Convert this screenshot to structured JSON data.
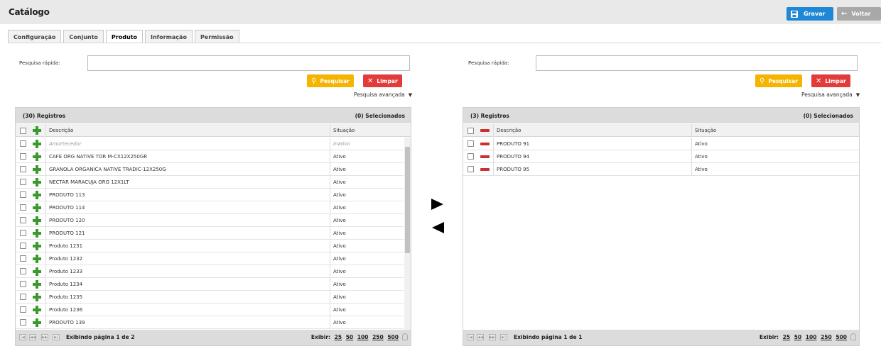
{
  "header": {
    "title": "Catálogo",
    "save_label": "Gravar",
    "back_label": "Voltar",
    "colors": {
      "save": "#1e88d6",
      "back": "#a8a8a8",
      "search": "#f5b400",
      "clear": "#e23b3b",
      "add": "#3a9a2c",
      "remove": "#cc2f2f"
    }
  },
  "tabs": [
    {
      "label": "Configuração",
      "active": false
    },
    {
      "label": "Conjunto",
      "active": false
    },
    {
      "label": "Produto",
      "active": true
    },
    {
      "label": "Informação",
      "active": false
    },
    {
      "label": "Permissão",
      "active": false
    }
  ],
  "left": {
    "search_label": "Pesquisa rápida:",
    "search_value": "",
    "search_button": "Pesquisar",
    "clear_button": "Limpar",
    "advanced": "Pesquisa avançada",
    "records": "(30) Registros",
    "selected": "(0) Selecionados",
    "col_desc": "Descrição",
    "col_status": "Situação",
    "rows": [
      {
        "desc": "Amortecedor",
        "status": "Inativo",
        "inactive": true
      },
      {
        "desc": "CAFE ORG NATIVE TOR M-CX12X250GR",
        "status": "Ativo"
      },
      {
        "desc": "GRANOLA ORGANICA NATIVE TRADIC-12X250G",
        "status": "Ativo"
      },
      {
        "desc": "NECTAR MARACUJA ORG 12X1LT",
        "status": "Ativo"
      },
      {
        "desc": "PRODUTO 113",
        "status": "Ativo"
      },
      {
        "desc": "PRODUTO 114",
        "status": "Ativo"
      },
      {
        "desc": "PRODUTO 120",
        "status": "Ativo"
      },
      {
        "desc": "PRODUTO 121",
        "status": "Ativo"
      },
      {
        "desc": "Produto 1231",
        "status": "Ativo"
      },
      {
        "desc": "Produto 1232",
        "status": "Ativo"
      },
      {
        "desc": "Produto 1233",
        "status": "Ativo"
      },
      {
        "desc": "Produto 1234",
        "status": "Ativo"
      },
      {
        "desc": "Produto 1235",
        "status": "Ativo"
      },
      {
        "desc": "Produto 1236",
        "status": "Ativo"
      },
      {
        "desc": "PRODUTO 139",
        "status": "Ativo"
      }
    ],
    "page_text": "Exibindo página 1 de 2",
    "show_label": "Exibir:",
    "page_sizes": [
      "25",
      "50",
      "100",
      "250",
      "500"
    ]
  },
  "right": {
    "search_label": "Pesquisa rápida:",
    "search_value": "",
    "search_button": "Pesquisar",
    "clear_button": "Limpar",
    "advanced": "Pesquisa avançada",
    "records": "(3) Registros",
    "selected": "(0) Selecionados",
    "col_desc": "Descrição",
    "col_status": "Situação",
    "rows": [
      {
        "desc": "PRODUTO 91",
        "status": "Ativo"
      },
      {
        "desc": "PRODUTO 94",
        "status": "Ativo"
      },
      {
        "desc": "PRODUTO 95",
        "status": "Ativo"
      }
    ],
    "page_text": "Exibindo página 1 de 1",
    "show_label": "Exibir:",
    "page_sizes": [
      "25",
      "50",
      "100",
      "250",
      "500"
    ]
  },
  "icons": {
    "save": "floppy-icon",
    "back": "arrow-left-icon",
    "search": "magnifier-icon",
    "clear": "x-icon",
    "add": "plus-icon",
    "remove": "minus-icon",
    "move_right": "triangle-right-icon",
    "move_left": "triangle-left-icon",
    "bulb": "lightbulb-icon"
  }
}
